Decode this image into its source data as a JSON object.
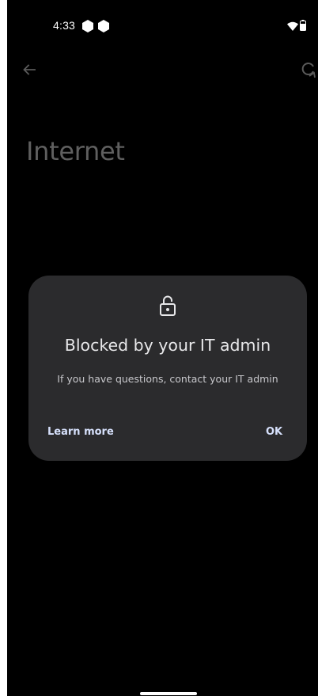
{
  "status_bar": {
    "time": "4:33"
  },
  "app_bar": {
    "title": "Internet"
  },
  "dialog": {
    "title": "Blocked by your IT admin",
    "message": "If you have questions, contact your IT admin",
    "learn_more_label": "Learn more",
    "ok_label": "OK"
  },
  "icons": {
    "status": [
      "hexagon-icon",
      "hexagon-icon",
      "wifi-icon",
      "battery-icon"
    ],
    "app_bar": [
      "back-arrow-icon",
      "refresh-icon"
    ],
    "dialog": "lock-icon"
  },
  "colors": {
    "background": "#000000",
    "dialog_surface": "#2b2b2d",
    "dialog_title": "#e8e8ea",
    "button_text": "#d6e0fb",
    "page_title": "#5f5f5f"
  }
}
